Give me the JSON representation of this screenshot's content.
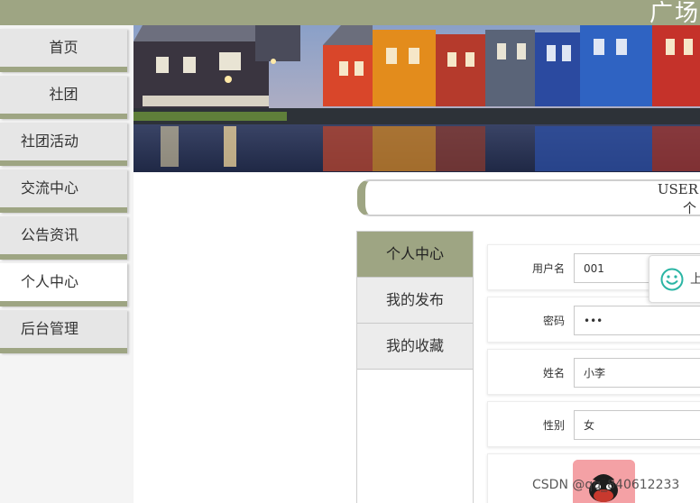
{
  "header": {
    "title": "广场"
  },
  "sidebar": {
    "items": [
      {
        "label": "首页"
      },
      {
        "label": "社团"
      },
      {
        "label": "社团活动"
      },
      {
        "label": "交流中心"
      },
      {
        "label": "公告资讯"
      },
      {
        "label": "个人中心"
      },
      {
        "label": "后台管理"
      }
    ],
    "active_index": 5
  },
  "user_center": {
    "title_en": "USER",
    "title_cn": "个"
  },
  "tabs": [
    {
      "label": "个人中心"
    },
    {
      "label": "我的发布"
    },
    {
      "label": "我的收藏"
    }
  ],
  "form": {
    "username": {
      "label": "用户名",
      "value": "001"
    },
    "password": {
      "label": "密码",
      "value": "•••"
    },
    "name": {
      "label": "姓名",
      "value": "小李"
    },
    "gender": {
      "label": "性别",
      "value": "女"
    }
  },
  "popup": {
    "text": "上"
  },
  "watermark": "CSDN @qq_840612233",
  "colors": {
    "accent": "#9ea583",
    "menu_bg": "#e6e6e6"
  }
}
